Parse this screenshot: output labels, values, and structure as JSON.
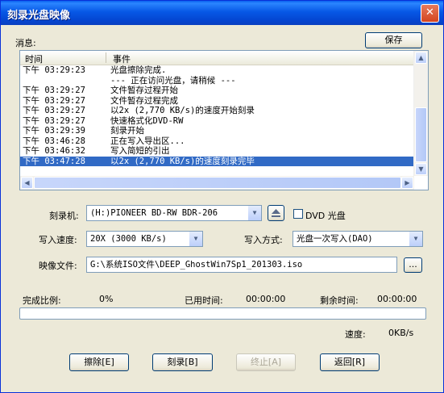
{
  "window": {
    "title": "刻录光盘映像",
    "close_glyph": "✕"
  },
  "messages": {
    "label": "消息:",
    "save_button": "保存",
    "columns": [
      "时间",
      "事件"
    ],
    "rows": [
      {
        "time": "下午 03:29:23",
        "event": "光盘擦除完成."
      },
      {
        "time": "",
        "event": "--- 正在访问光盘，请稍候 ---"
      },
      {
        "time": "下午 03:29:27",
        "event": "文件暂存过程开始"
      },
      {
        "time": "下午 03:29:27",
        "event": "文件暂存过程完成"
      },
      {
        "time": "下午 03:29:27",
        "event": "以2x (2,770 KB/s)的速度开始刻录"
      },
      {
        "time": "下午 03:29:27",
        "event": "快速格式化DVD-RW"
      },
      {
        "time": "下午 03:29:39",
        "event": "刻录开始"
      },
      {
        "time": "下午 03:46:28",
        "event": "正在写入导出区..."
      },
      {
        "time": "下午 03:46:32",
        "event": "写入简短的引出"
      },
      {
        "time": "下午 03:47:28",
        "event": "以2x (2,770 KB/s)的速度刻录完毕",
        "selected": true
      }
    ]
  },
  "burner": {
    "label": "刻录机:",
    "value": "(H:)PIONEER  BD-RW   BDR-206",
    "dvd_disc_label": "DVD 光盘"
  },
  "write_speed": {
    "label": "写入速度:",
    "value": "20X (3000 KB/s)"
  },
  "write_mode": {
    "label": "写入方式:",
    "value": "光盘一次写入(DAO)"
  },
  "image_file": {
    "label": "映像文件:",
    "value": "G:\\系统ISO文件\\DEEP_GhostWin7Sp1_201303.iso",
    "browse_button": "..."
  },
  "progress": {
    "complete_label": "完成比例:",
    "complete_value": "0%",
    "elapsed_label": "已用时间:",
    "elapsed_value": "00:00:00",
    "remaining_label": "剩余时间:",
    "remaining_value": "00:00:00",
    "speed_label": "速度:",
    "speed_value": "0KB/s",
    "fraction": 0
  },
  "buttons": {
    "erase": "擦除[E]",
    "burn": "刻录[B]",
    "stop": "终止[A]",
    "back": "返回[R]"
  },
  "icons": {
    "eject": "eject-icon",
    "dropdown": "chevron-down-icon"
  }
}
